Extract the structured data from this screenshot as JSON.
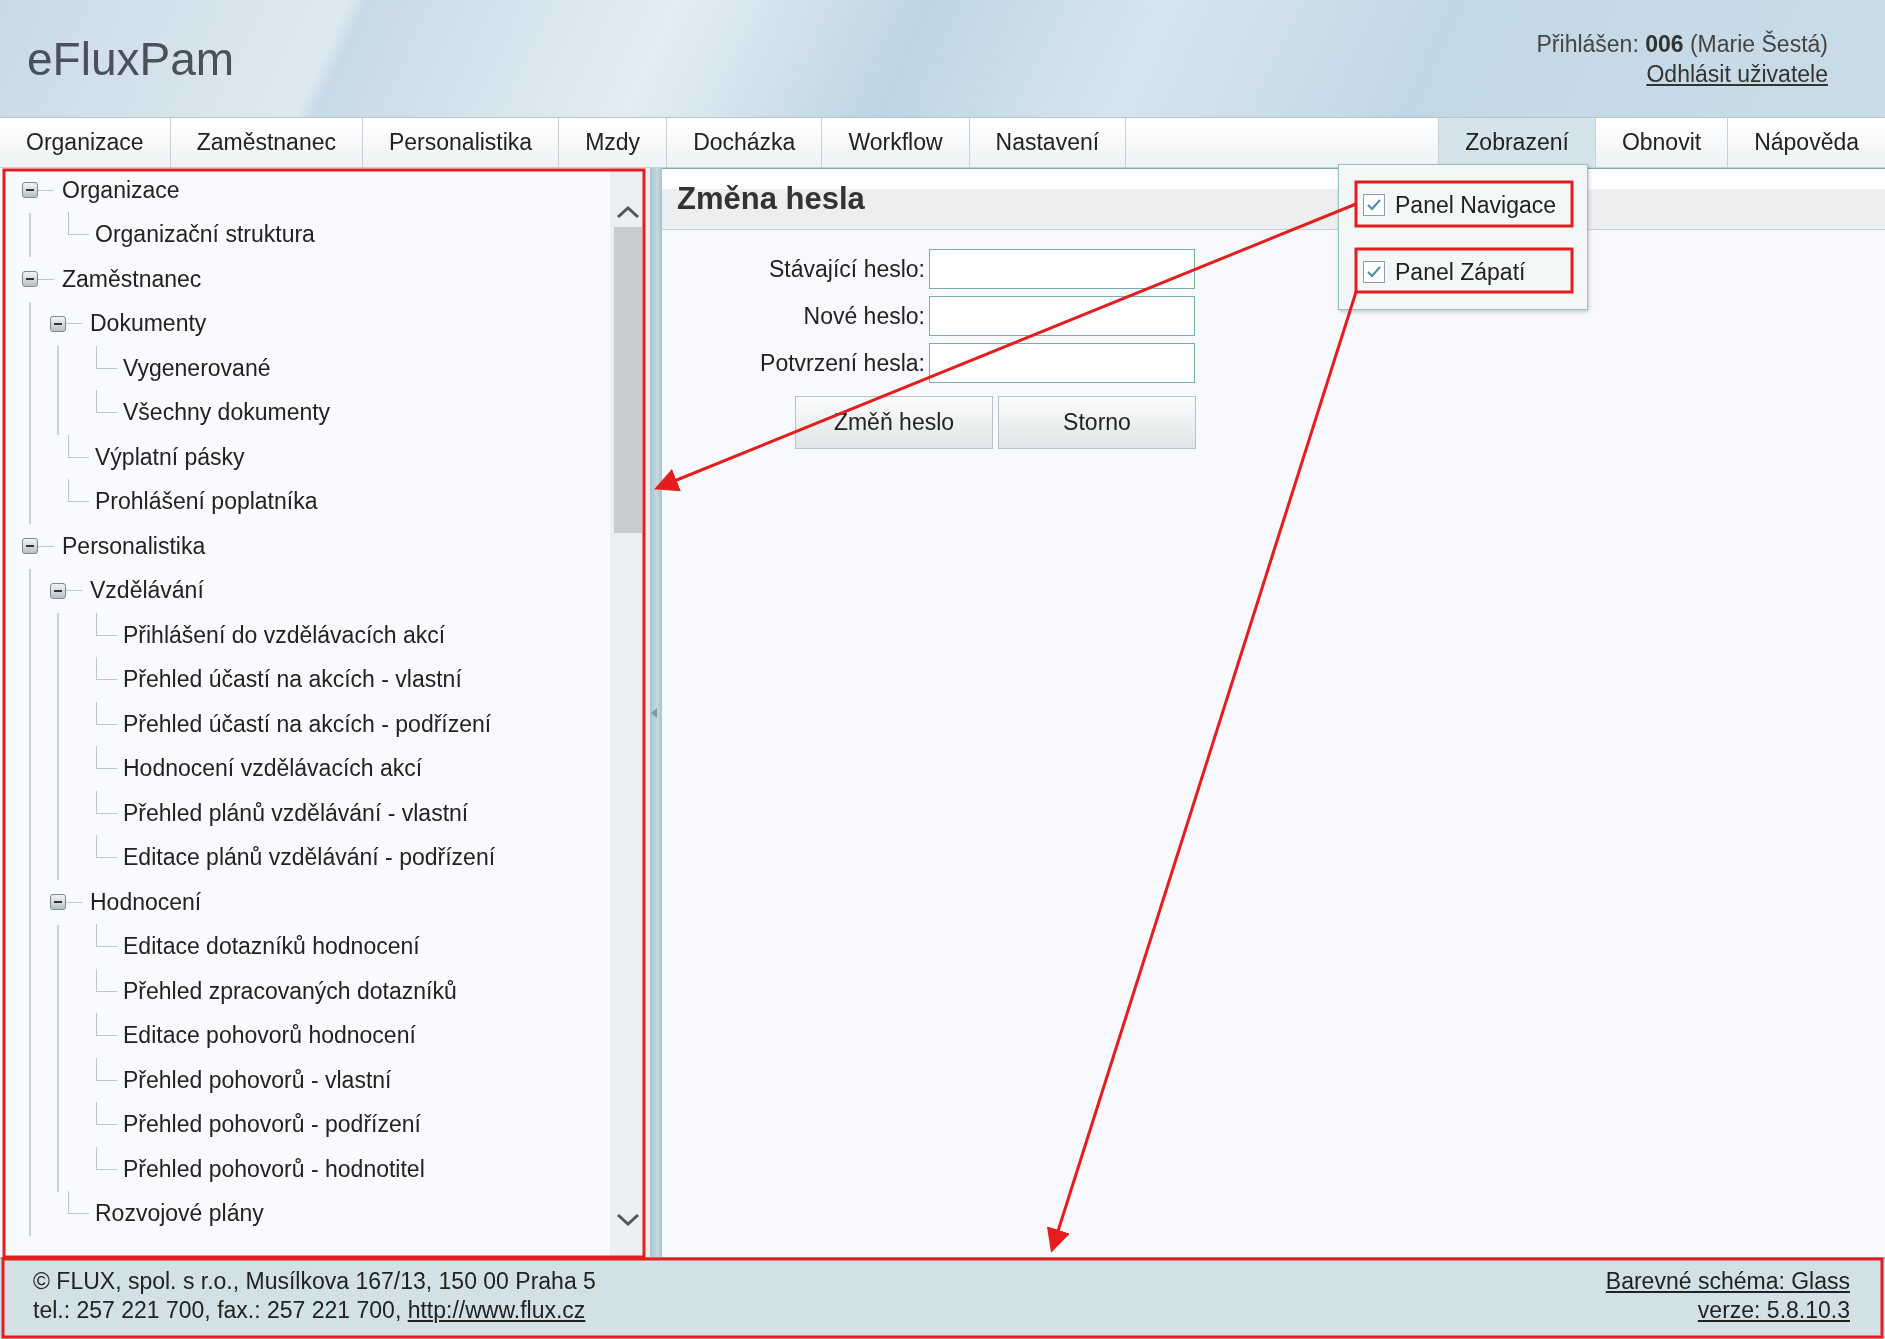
{
  "app_title": "eFluxPam",
  "user": {
    "signed_in": "Přihlášen: **006** (Marie Šestá)",
    "logout": "Odhlásit uživatele"
  },
  "menu": [
    {
      "label": "Organizace",
      "selected": false
    },
    {
      "label": "Zaměstnanec",
      "selected": false
    },
    {
      "label": "Personalistika",
      "selected": false
    },
    {
      "label": "Mzdy",
      "selected": false
    },
    {
      "label": "Docházka",
      "selected": false
    },
    {
      "label": "Workflow",
      "selected": false
    },
    {
      "label": "Nastavení",
      "selected": false
    }
  ],
  "menu_right": [
    {
      "label": "Zobrazení",
      "selected": true
    },
    {
      "label": "Obnovit",
      "selected": false
    },
    {
      "label": "Nápověda",
      "selected": false
    }
  ],
  "view_menu": [
    {
      "label": "Panel Navigace",
      "checked": true
    },
    {
      "label": "Panel Zápatí",
      "checked": true
    }
  ],
  "tree": [
    {
      "label": "Organizace",
      "expanded": true,
      "children": [
        {
          "label": "Organizační struktura"
        }
      ]
    },
    {
      "label": "Zaměstnanec",
      "expanded": true,
      "children": [
        {
          "label": "Dokumenty",
          "expanded": true,
          "children": [
            {
              "label": "Vygenerované"
            },
            {
              "label": "Všechny dokumenty"
            }
          ]
        },
        {
          "label": "Výplatní pásky"
        },
        {
          "label": "Prohlášení poplatníka"
        }
      ]
    },
    {
      "label": "Personalistika",
      "expanded": true,
      "children": [
        {
          "label": "Vzdělávání",
          "expanded": true,
          "children": [
            {
              "label": "Přihlášení do vzdělávacích akcí"
            },
            {
              "label": "Přehled účastí na akcích - vlastní"
            },
            {
              "label": "Přehled účastí na akcích - podřízení"
            },
            {
              "label": "Hodnocení vzdělávacích akcí"
            },
            {
              "label": "Přehled plánů vzdělávání - vlastní"
            },
            {
              "label": "Editace plánů vzdělávání - podřízení"
            }
          ]
        },
        {
          "label": "Hodnocení",
          "expanded": true,
          "children": [
            {
              "label": "Editace dotazníků hodnocení"
            },
            {
              "label": "Přehled zpracovaných dotazníků"
            },
            {
              "label": "Editace pohovorů hodnocení"
            },
            {
              "label": "Přehled pohovorů - vlastní"
            },
            {
              "label": "Přehled pohovorů - podřízení"
            },
            {
              "label": "Přehled pohovorů - hodnotitel"
            }
          ]
        },
        {
          "label": "Rozvojové plány"
        }
      ]
    }
  ],
  "form": {
    "title": "Změna hesla",
    "fields": [
      {
        "label": "Stávající heslo:"
      },
      {
        "label": "Nové heslo:"
      },
      {
        "label": "Potvrzení hesla:"
      }
    ],
    "buttons": [
      "Změň heslo",
      "Storno"
    ]
  },
  "footer": {
    "address": "© FLUX, spol. s r.o., Musílkova 167/13, 150 00 Praha 5",
    "contact": "tel.: 257 221 700, fax.: 257 221 700, ",
    "website": "http://www.flux.cz",
    "scheme": "Barevné schéma: Glass",
    "version": "verze: 5.8.10.3"
  }
}
